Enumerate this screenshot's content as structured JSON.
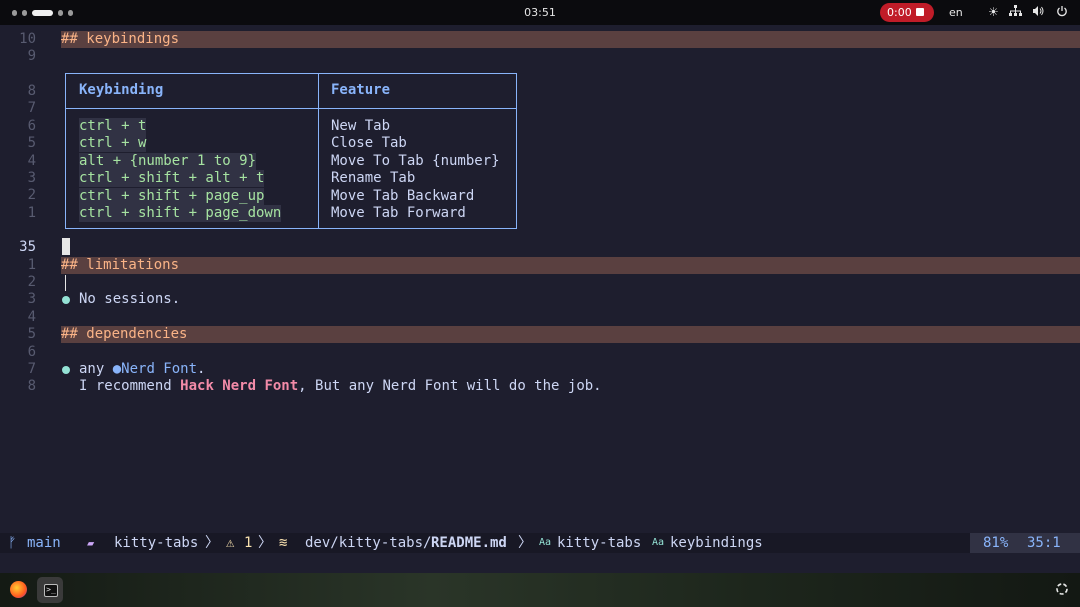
{
  "topbar": {
    "clock": "03:51",
    "recording_time": "0:00",
    "language": "en",
    "icons": [
      "brightness-icon",
      "network-icon",
      "volume-icon",
      "power-icon"
    ]
  },
  "editor": {
    "line_numbers": [
      "10",
      "9",
      "8",
      "7",
      "6",
      "5",
      "4",
      "3",
      "2",
      "1",
      "35",
      "1",
      "2",
      "3",
      "4",
      "5",
      "6",
      "7",
      "8"
    ],
    "heading_keybindings": "## keybindings",
    "heading_limitations": "## limitations",
    "heading_dependencies": "## dependencies",
    "table": {
      "headers": [
        "Keybinding",
        "Feature"
      ],
      "rows": [
        [
          "ctrl + t",
          "New Tab"
        ],
        [
          "ctrl + w",
          "Close Tab"
        ],
        [
          "alt + {number 1 to 9}",
          "Move To Tab {number}"
        ],
        [
          "ctrl + shift + alt + t",
          "Rename Tab"
        ],
        [
          "ctrl + shift + page_up",
          "Move Tab Backward"
        ],
        [
          "ctrl + shift + page_down",
          "Move Tab Forward"
        ]
      ]
    },
    "limitations_item": "No sessions.",
    "dependency_prefix": "any ",
    "dependency_link": "Nerd Font",
    "dependency_suffix": ".",
    "recommend_prefix": "I recommend ",
    "recommend_strong": "Hack Nerd Font",
    "recommend_suffix": ", But any Nerd Font will do the job."
  },
  "statusline": {
    "branch": "main",
    "project": "kitty-tabs",
    "warnings": "1",
    "path_prefix": "dev/kitty-tabs/",
    "path_file": "README.md",
    "crumb1": "kitty-tabs",
    "crumb2": "keybindings",
    "percent": "81%",
    "position": "35:1"
  },
  "colors": {
    "background": "#1e1e2e",
    "heading": "#fab387",
    "table_border": "#89b4fa",
    "code": "#a6e3a1",
    "strong": "#f38ba8",
    "record": "#c01c28"
  }
}
